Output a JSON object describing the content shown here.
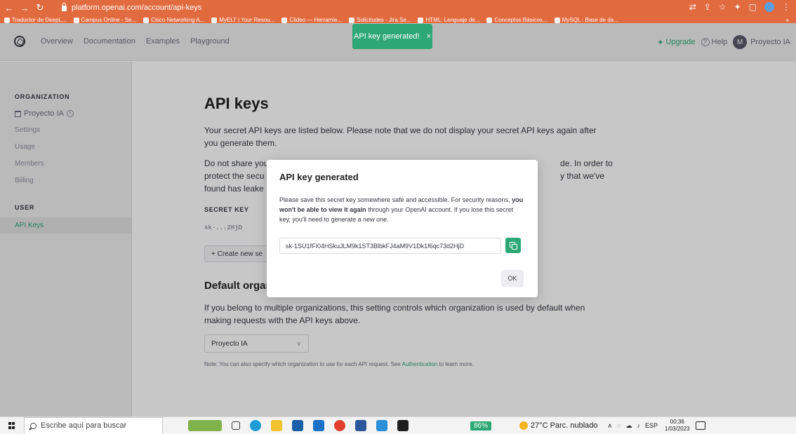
{
  "browser": {
    "url": "platform.openai.com/account/api-keys",
    "bookmarks": [
      "Traductor de DeepL...",
      "Campus Online - Se...",
      "Cisco Networking A...",
      "MyELT | Your Resou...",
      "Clideo — Herramie...",
      "Solicitudes - Jira Se...",
      "HTML: Lenguaje de...",
      "Conceptos Básicos...",
      "MySQL : Base de da..."
    ],
    "more_bookmarks": "»"
  },
  "header": {
    "nav": [
      "Overview",
      "Documentation",
      "Examples",
      "Playground"
    ],
    "upgrade": "Upgrade",
    "help": "Help",
    "org_initial": "M",
    "org_name": "Proyecto IA"
  },
  "toast": {
    "text": "API key generated!",
    "close": "×"
  },
  "sidebar": {
    "org_heading": "ORGANIZATION",
    "org_name": "Proyecto IA",
    "org_items": [
      "Settings",
      "Usage",
      "Members",
      "Billing"
    ],
    "user_heading": "USER",
    "user_items": [
      "API Keys"
    ]
  },
  "main": {
    "title": "API keys",
    "para1": "Your secret API keys are listed below. Please note that we do not display your secret API keys again after you generate them.",
    "para2_left_lines": [
      "Do not share you",
      "protect the secu",
      "found has leake"
    ],
    "para2_right_lines": [
      "de. In order to",
      "y that we've"
    ],
    "table_header": "SECRET KEY",
    "key_masked": "sk-...2HjD",
    "create_button": "+ Create new se",
    "section_title": "Default organ",
    "section_text": "If you belong to multiple organizations, this setting controls which organization is used by default when making requests with the API keys above.",
    "org_select_value": "Proyecto IA",
    "note_prefix": "Note: You can also specify which organization to use for each API request. See ",
    "note_link": "Authentication",
    "note_suffix": " to learn more."
  },
  "modal": {
    "title": "API key generated",
    "text_1": "Please save this secret key somewhere safe and accessible. For security reasons, ",
    "text_bold": "you won't be able to view it again",
    "text_2": " through your OpenAI account. If you lose this secret key, you'll need to generate a new one.",
    "key": "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",
    "ok": "OK"
  },
  "taskbar": {
    "search_placeholder": "Escribe aquí para buscar",
    "battery": "86%",
    "weather": "27°C  Parc. nublado",
    "lang": "ESP",
    "time": "00:36",
    "date": "1/03/2023"
  },
  "colors": {
    "accent": "#2ea776",
    "chrome": "#e26a3f",
    "sidebar_bg": "#efefef"
  }
}
